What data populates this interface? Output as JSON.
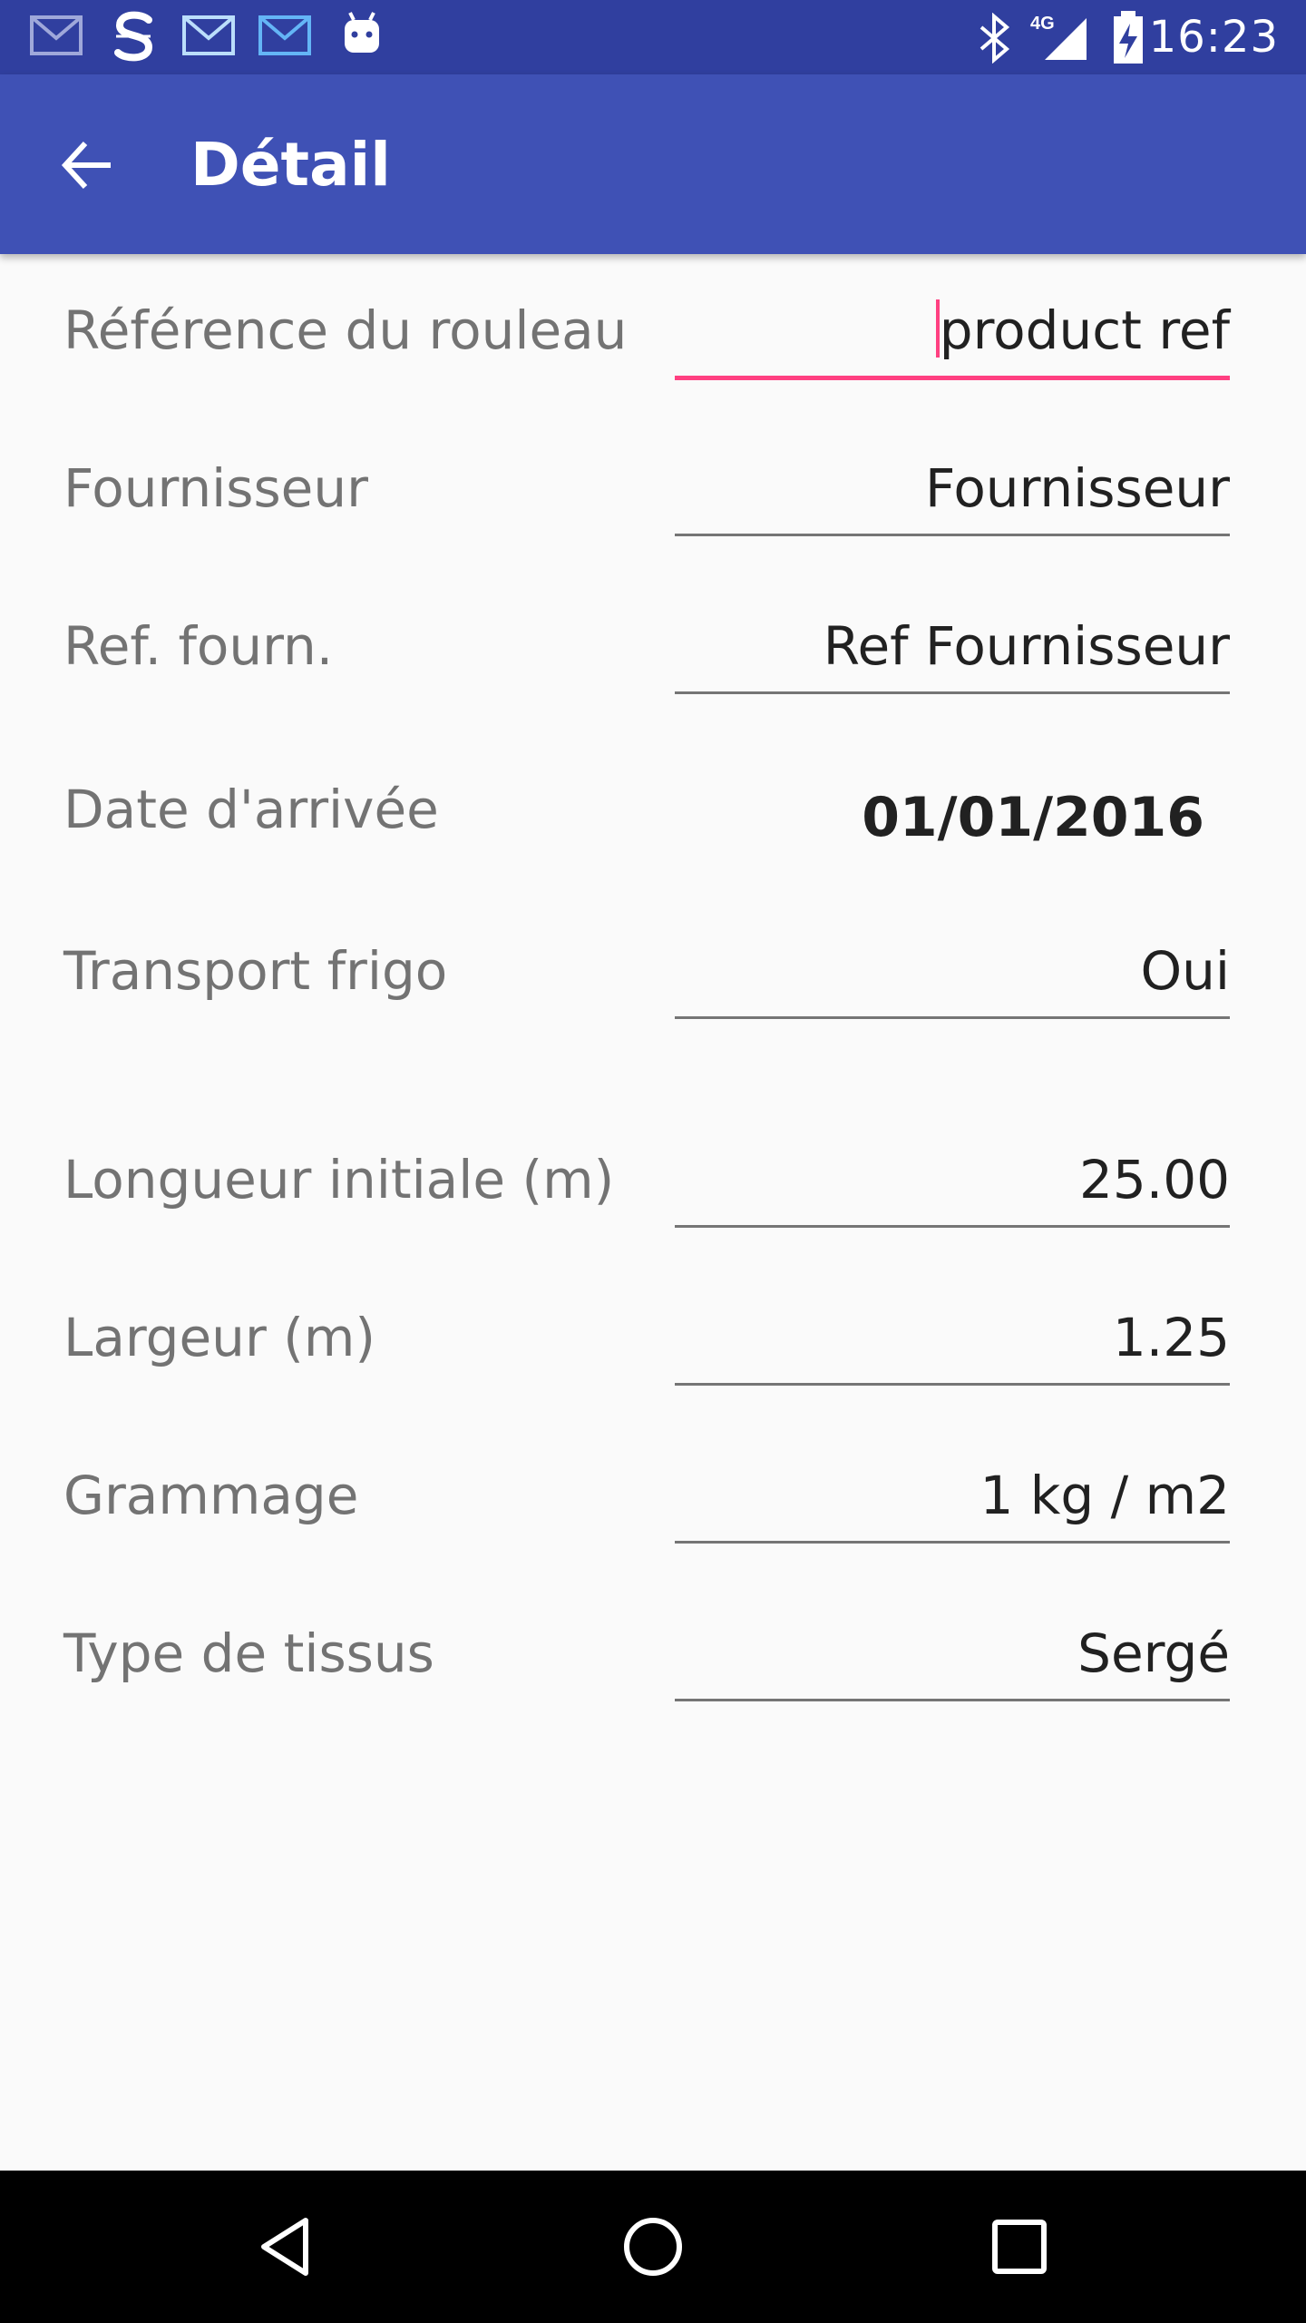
{
  "status_bar": {
    "time": "16:23",
    "network": "4G",
    "notification_icons": [
      "gmail-icon",
      "s-app-icon",
      "email-icon",
      "inbox-icon",
      "android-icon"
    ],
    "system_icons": [
      "bluetooth-icon",
      "signal-icon",
      "battery-charging-icon"
    ]
  },
  "app_bar": {
    "title": "Détail",
    "back_icon": "arrow-back-icon"
  },
  "form": {
    "rows": [
      {
        "label": "Référence du rouleau",
        "value": "product ref",
        "focused": true
      },
      {
        "label": "Fournisseur",
        "value": "Fournisseur"
      },
      {
        "label": "Ref. fourn.",
        "value": "Ref Fournisseur"
      },
      {
        "label": "Date d'arrivée",
        "value": "01/01/2016"
      },
      {
        "label": "Transport frigo",
        "value": "Oui"
      },
      {
        "label": "Longueur initiale (m)",
        "value": "25.00"
      },
      {
        "label": "Largeur (m)",
        "value": "1.25"
      },
      {
        "label": "Grammage",
        "value": "1 kg / m2"
      },
      {
        "label": "Type de tissus",
        "value": "Sergé"
      }
    ]
  },
  "nav_bar": {
    "buttons": [
      "back-triangle-icon",
      "home-circle-icon",
      "recents-square-icon"
    ]
  },
  "colors": {
    "status_bar": "#303f9f",
    "app_bar": "#3f51b5",
    "accent": "#ff4081",
    "background": "#fafafa"
  }
}
